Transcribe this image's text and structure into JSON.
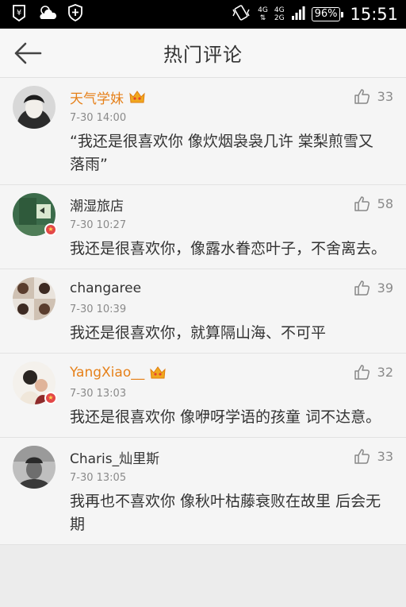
{
  "status": {
    "net_top": "4G",
    "net_top2": "4G",
    "net_bottom": "2G",
    "battery": "96%",
    "time": "15:51"
  },
  "header": {
    "title": "热门评论"
  },
  "comments": [
    {
      "user": "天气学妹",
      "time": "7-30 14:00",
      "likes": "33",
      "text": "“我还是很喜欢你 像炊烟袅袅几许 棠梨煎雪又落雨”"
    },
    {
      "user": "潮湿旅店",
      "time": "7-30 10:27",
      "likes": "58",
      "text": "我还是很喜欢你，像露水眷恋叶子，不舍离去。"
    },
    {
      "user": "changaree",
      "time": "7-30 10:39",
      "likes": "39",
      "text": "我还是很喜欢你，就算隔山海、不可平"
    },
    {
      "user": "YangXiao__",
      "time": "7-30 13:03",
      "likes": "32",
      "text": "我还是很喜欢你 像咿呀学语的孩童 词不达意。"
    },
    {
      "user": "Charis_灿里斯",
      "time": "7-30 13:05",
      "likes": "33",
      "text": "我再也不喜欢你 像秋叶枯藤衰败在故里 后会无期"
    }
  ],
  "colors": {
    "vip_name": "#e6811a",
    "time": "#8a8a8a",
    "statusbar": "#000000"
  }
}
